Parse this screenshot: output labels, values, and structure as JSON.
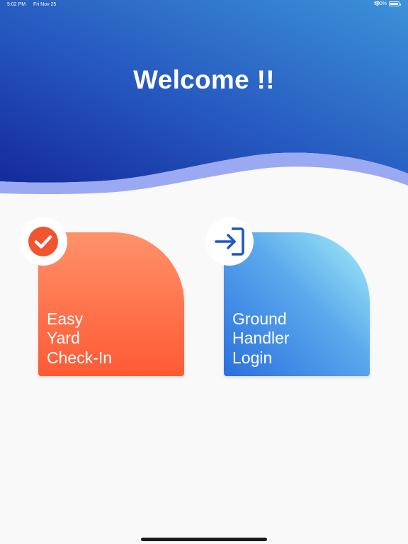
{
  "status_bar": {
    "time": "5:02 PM",
    "date": "Fri Nov 25",
    "battery": "100%",
    "wifi_icon": "wifi-icon",
    "battery_icon": "battery-icon"
  },
  "header": {
    "title": "Welcome !!",
    "colors": {
      "gradient_start": "#1a2e9c",
      "gradient_end": "#3a8fd6",
      "wave_accent": "#9aa9f2"
    }
  },
  "tiles": [
    {
      "label": "Easy\nYard\nCheck-In",
      "icon": "checkmark-circle-icon",
      "color_top": "#ff9269",
      "color_bottom": "#ff5a35"
    },
    {
      "label": "Ground\nHandler\nLogin",
      "icon": "login-icon",
      "color_top": "#a6eff7",
      "color_bottom": "#2b6fde"
    }
  ]
}
